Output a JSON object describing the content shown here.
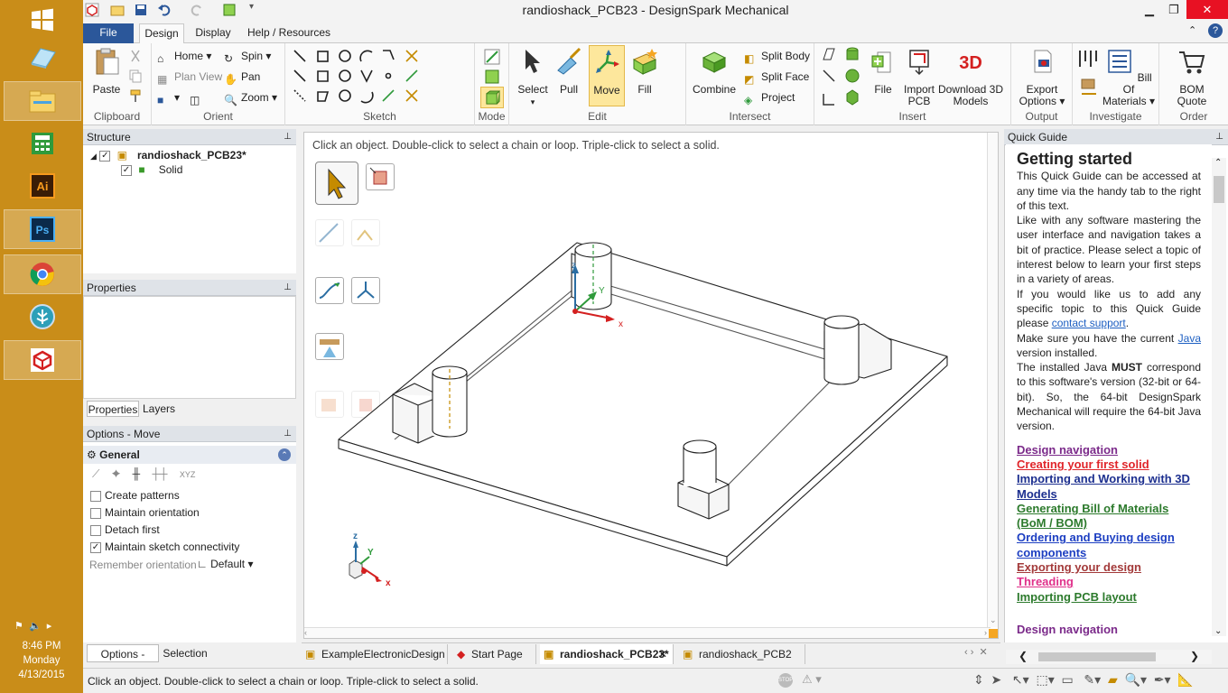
{
  "window": {
    "title": "randioshack_PCB23 - DesignSpark Mechanical"
  },
  "ribbon_tabs": [
    "File",
    "Design",
    "Display",
    "Help / Resources"
  ],
  "groups": {
    "clipboard": {
      "label": "Clipboard",
      "paste": "Paste"
    },
    "orient": {
      "label": "Orient",
      "home": "Home",
      "spin": "Spin",
      "plan_view": "Plan View",
      "pan": "Pan",
      "zoom": "Zoom"
    },
    "sketch": {
      "label": "Sketch"
    },
    "mode": {
      "label": "Mode"
    },
    "edit": {
      "label": "Edit",
      "select": "Select",
      "pull": "Pull",
      "move": "Move",
      "fill": "Fill"
    },
    "intersect": {
      "label": "Intersect",
      "combine": "Combine",
      "split_body": "Split Body",
      "split_face": "Split Face",
      "project": "Project"
    },
    "insert": {
      "label": "Insert",
      "file": "File",
      "import_pcb_1": "Import",
      "import_pcb_2": "PCB",
      "download_1": "Download 3D",
      "download_2": "Models"
    },
    "output": {
      "label": "Output",
      "export_1": "Export",
      "export_2": "Options"
    },
    "investigate": {
      "label": "Investigate",
      "bom_1": "Bill Of",
      "bom_2": "Materials"
    },
    "order": {
      "label": "Order",
      "bom_quote_1": "BOM",
      "bom_quote_2": "Quote"
    }
  },
  "structure": {
    "title": "Structure",
    "root": "randioshack_PCB23*",
    "child": "Solid"
  },
  "properties": {
    "title": "Properties",
    "tab1": "Properties",
    "tab2": "Layers"
  },
  "options": {
    "title": "Options - Move",
    "section": "General",
    "items": [
      {
        "label": "Create patterns",
        "checked": false
      },
      {
        "label": "Maintain orientation",
        "checked": false
      },
      {
        "label": "Detach first",
        "checked": false
      },
      {
        "label": "Maintain sketch connectivity",
        "checked": true
      }
    ],
    "remember_label": "Remember orientation",
    "remember_value": "Default",
    "tab1": "Options - Move",
    "tab2": "Selection"
  },
  "viewport": {
    "hint": "Click an object.  Double-click to select a chain or loop.  Triple-click to select a solid."
  },
  "doc_tabs": [
    "ExampleElectronicDesign",
    "Start Page",
    "randioshack_PCB23*",
    "randioshack_PCB2"
  ],
  "quick_guide": {
    "panel_title": "Quick Guide",
    "heading": "Getting started",
    "p1": "This Quick Guide can be accessed at any time via the handy tab to the right of this text.",
    "p2": "Like with any software mastering the user interface and navigation takes a bit of practice. Please select a topic of interest below to learn your first steps in a variety of areas.",
    "p3a": "If you would like us to add any specific topic to this Quick Guide please ",
    "p3_link": "contact support",
    "p3b": ".",
    "p4a": "Make sure you have the current ",
    "p4_link": "Java",
    "p4b": " version installed.",
    "p5a": "The installed Java ",
    "p5_bold": "MUST",
    "p5b": " correspond to this software's version (32-bit or 64-bit). So, the 64-bit DesignSpark Mechanical will require the 64-bit Java version.",
    "links": [
      {
        "text": "Design navigation",
        "color": "#7b2a8a"
      },
      {
        "text": "Creating your first solid",
        "color": "#e0262b"
      },
      {
        "text": "Importing and Working with 3D Models",
        "color": "#1c2f8f"
      },
      {
        "text": "Generating Bill of Materials (BoM / BOM)",
        "color": "#2c7a2c"
      },
      {
        "text": "Ordering and Buying design components",
        "color": "#1d3fc2"
      },
      {
        "text": "Exporting your design",
        "color": "#a33a3a"
      },
      {
        "text": "Threading",
        "color": "#e0308a"
      },
      {
        "text": "Importing PCB layout",
        "color": "#2c7a2c"
      }
    ],
    "footer_heading": "Design navigation"
  },
  "status": {
    "text": "Click an object.  Double-click to select a chain or loop.  Triple-click to select a solid."
  },
  "clock": {
    "time": "8:46 PM",
    "day": "Monday",
    "date": "4/13/2015"
  },
  "axes": {
    "x": "x",
    "y": "Y",
    "z": "z"
  },
  "colors": {
    "taskbar": "#c98d19",
    "accent": "#2b579a",
    "file_tab": "#2b579a"
  }
}
